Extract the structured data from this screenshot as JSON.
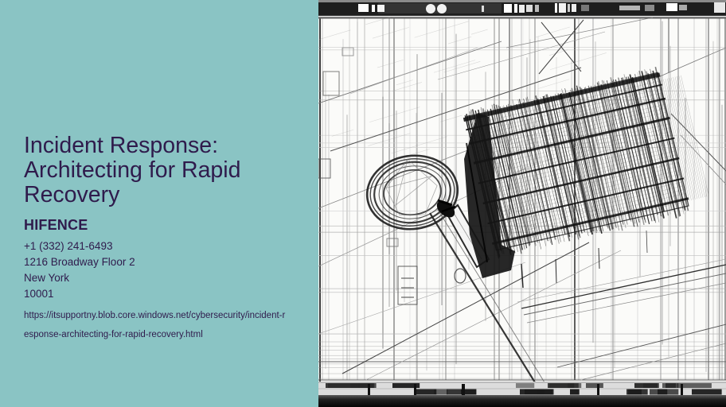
{
  "card": {
    "title": "Incident Response: Architecting for Rapid Recovery",
    "company": "HIFENCE",
    "phone": "+1 (332) 241-6493",
    "address_street": "1216 Broadway Floor 2",
    "address_city": "New York",
    "address_zip": "10001",
    "url_line1": "https://itsupportny.blob.core.windows.net/cybersecurity/incident-r",
    "url_line2": "esponse-architecting-for-rapid-recovery.html"
  },
  "illustration": {
    "name": "wireframe-architectural-sketch",
    "description": "black and white pencil wireframe sketch of a caged box structure with magnifying-glass ring, filmstrip bars top and bottom"
  },
  "colors": {
    "panel_bg": "#8ac4c4",
    "text": "#2f1b4c",
    "sketch_bg": "#fbfbfa",
    "sketch_ink": "#141414",
    "bar_dark": "#1e1e1e"
  }
}
